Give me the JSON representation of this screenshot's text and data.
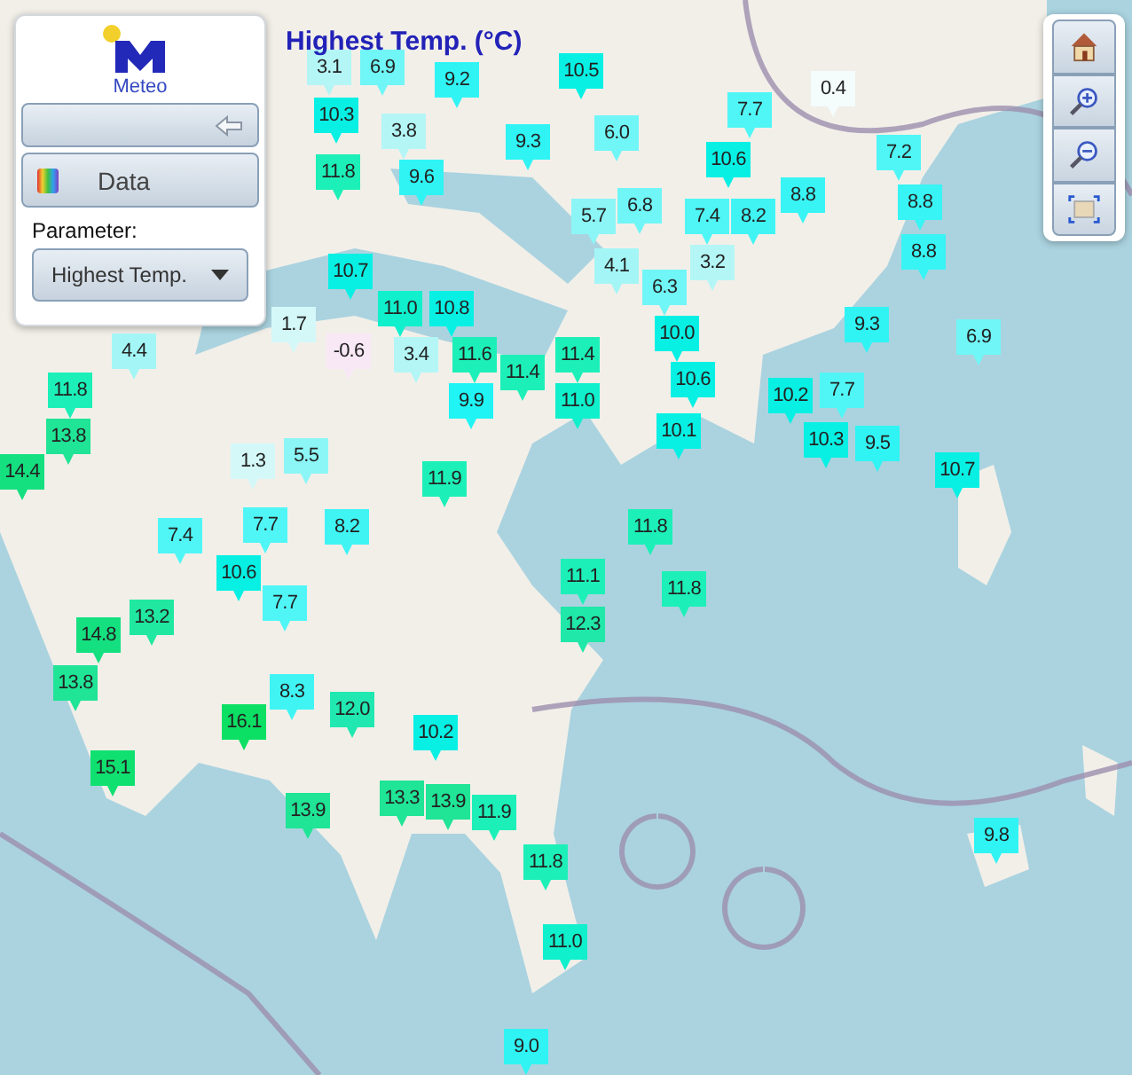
{
  "title": "Highest Temp. (°C)",
  "panel": {
    "logo_text": "Meteo",
    "data_button": "Data",
    "parameter_label": "Parameter:",
    "parameter_select": "Highest Temp."
  },
  "markers": [
    {
      "value": "3.1",
      "color": "#b4f6f6"
    },
    {
      "value": "6.9",
      "color": "#70f6f6"
    },
    {
      "value": "9.2",
      "color": "#30f4f4"
    },
    {
      "value": "10.5",
      "color": "#08f0e4"
    },
    {
      "value": "10.3",
      "color": "#08f0e4"
    },
    {
      "value": "3.8",
      "color": "#b4f6f6"
    },
    {
      "value": "6.0",
      "color": "#70f6f6"
    },
    {
      "value": "9.3",
      "color": "#30f4f4"
    },
    {
      "value": "0.4",
      "color": "#f4fcfc"
    },
    {
      "value": "7.7",
      "color": "#50f6f6"
    },
    {
      "value": "11.8",
      "color": "#1cf0b8"
    },
    {
      "value": "9.6",
      "color": "#30f4f4"
    },
    {
      "value": "10.6",
      "color": "#08f0e4"
    },
    {
      "value": "7.2",
      "color": "#50f6f6"
    },
    {
      "value": "5.7",
      "color": "#8cf6f6"
    },
    {
      "value": "6.8",
      "color": "#70f6f6"
    },
    {
      "value": "7.4",
      "color": "#50f6f6"
    },
    {
      "value": "8.2",
      "color": "#40f4f4"
    },
    {
      "value": "8.8",
      "color": "#38f4f4"
    },
    {
      "value": "8.8",
      "color": "#38f4f4"
    },
    {
      "value": "8.8",
      "color": "#38f4f4"
    },
    {
      "value": "4.1",
      "color": "#a4f6f6"
    },
    {
      "value": "3.2",
      "color": "#b4f6f6"
    },
    {
      "value": "10.7",
      "color": "#08f0e4"
    },
    {
      "value": "6.3",
      "color": "#70f6f6"
    },
    {
      "value": "11.0",
      "color": "#10f0cc"
    },
    {
      "value": "1.7",
      "color": "#d4f8f8"
    },
    {
      "value": "10.8",
      "color": "#08f0e4"
    },
    {
      "value": "-0.6",
      "color": "#f8e8f6"
    },
    {
      "value": "3.4",
      "color": "#b4f6f6"
    },
    {
      "value": "10.0",
      "color": "#08f0e4"
    },
    {
      "value": "9.3",
      "color": "#30f4f4"
    },
    {
      "value": "6.9",
      "color": "#70f6f6"
    },
    {
      "value": "4.4",
      "color": "#a4f6f6"
    },
    {
      "value": "11.6",
      "color": "#1cf0b8"
    },
    {
      "value": "11.4",
      "color": "#1cf0b8"
    },
    {
      "value": "11.4",
      "color": "#1cf0b8"
    },
    {
      "value": "10.6",
      "color": "#08f0e4"
    },
    {
      "value": "11.8",
      "color": "#1cf0b8"
    },
    {
      "value": "9.9",
      "color": "#20f4f4"
    },
    {
      "value": "11.0",
      "color": "#10f0cc"
    },
    {
      "value": "10.2",
      "color": "#08f0e4"
    },
    {
      "value": "7.7",
      "color": "#50f6f6"
    },
    {
      "value": "13.8",
      "color": "#20e496"
    },
    {
      "value": "10.1",
      "color": "#08f0e4"
    },
    {
      "value": "10.3",
      "color": "#08f0e4"
    },
    {
      "value": "9.5",
      "color": "#30f4f4"
    },
    {
      "value": "14.4",
      "color": "#14e080"
    },
    {
      "value": "1.3",
      "color": "#d4f8f8"
    },
    {
      "value": "5.5",
      "color": "#8cf6f6"
    },
    {
      "value": "11.9",
      "color": "#1cf0b8"
    },
    {
      "value": "10.7",
      "color": "#08f0e4"
    },
    {
      "value": "7.7",
      "color": "#50f6f6"
    },
    {
      "value": "7.4",
      "color": "#50f6f6"
    },
    {
      "value": "8.2",
      "color": "#40f4f4"
    },
    {
      "value": "11.8",
      "color": "#1cf0b8"
    },
    {
      "value": "10.6",
      "color": "#08f0e4"
    },
    {
      "value": "11.1",
      "color": "#1cf0b8"
    },
    {
      "value": "7.7",
      "color": "#50f6f6"
    },
    {
      "value": "11.8",
      "color": "#1cf0b8"
    },
    {
      "value": "13.2",
      "color": "#20e8a0"
    },
    {
      "value": "12.3",
      "color": "#20e8a8"
    },
    {
      "value": "14.8",
      "color": "#14e080"
    },
    {
      "value": "13.8",
      "color": "#20e496"
    },
    {
      "value": "8.3",
      "color": "#40f4f4"
    },
    {
      "value": "12.0",
      "color": "#20e8b0"
    },
    {
      "value": "16.1",
      "color": "#0ce064"
    },
    {
      "value": "10.2",
      "color": "#08f0e4"
    },
    {
      "value": "15.1",
      "color": "#10e070"
    },
    {
      "value": "13.3",
      "color": "#20e496"
    },
    {
      "value": "13.9",
      "color": "#20e496"
    },
    {
      "value": "11.9",
      "color": "#1cf0b8"
    },
    {
      "value": "13.9",
      "color": "#20e496"
    },
    {
      "value": "9.8",
      "color": "#30f4f4"
    },
    {
      "value": "11.8",
      "color": "#1cf0b8"
    },
    {
      "value": "11.0",
      "color": "#10f0cc"
    },
    {
      "value": "9.0",
      "color": "#30f4f4"
    }
  ]
}
